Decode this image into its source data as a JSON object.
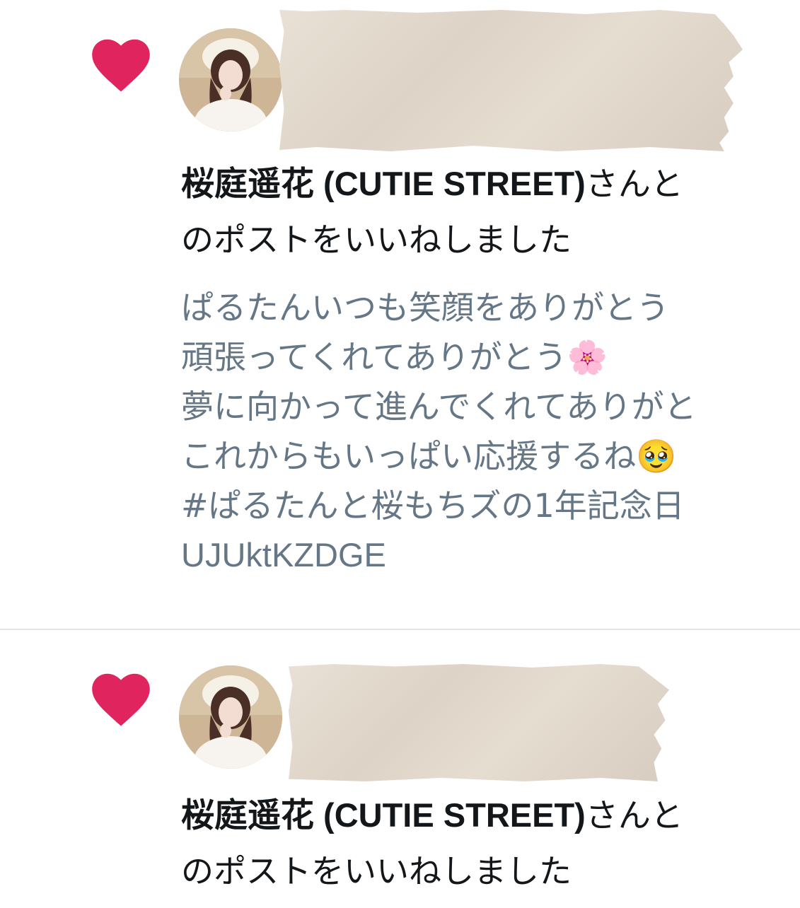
{
  "notifications": [
    {
      "actor_name": "桜庭遥花 (CUTIE STREET)",
      "actor_suffix": "さんと",
      "action_text": "のポストをいいねしました",
      "tweet_lines": [
        "ぱるたんいつも笑顔をありがとう",
        "頑張ってくれてありがとう🌸",
        "夢に向かって進んでくれてありがと",
        "これからもいっぱい応援するね🥹",
        "#ぱるたんと桜もちズの1年記念日",
        "UJUktKZDGE"
      ]
    },
    {
      "actor_name": "桜庭遥花 (CUTIE STREET)",
      "actor_suffix": "さんと",
      "action_text": "のポストをいいねしました"
    }
  ],
  "colors": {
    "heart": "#e0245e",
    "primary_text": "#14171a",
    "secondary_text": "#657786",
    "divider": "#e1e4e8",
    "tape": "#e2d9cd"
  },
  "icons": {
    "like": "heart-icon",
    "avatar": "profile-photo"
  }
}
